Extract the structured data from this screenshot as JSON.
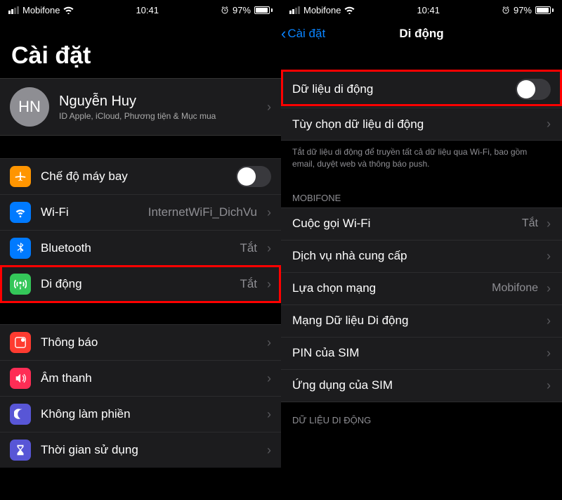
{
  "status": {
    "carrier": "Mobifone",
    "time": "10:41",
    "battery_pct": "97%"
  },
  "left": {
    "title": "Cài đặt",
    "profile": {
      "initials": "HN",
      "name": "Nguyễn Huy",
      "subtitle": "ID Apple, iCloud, Phương tiện & Mục mua"
    },
    "rows": {
      "airplane": "Chế độ máy bay",
      "wifi": "Wi-Fi",
      "wifi_value": "InternetWiFi_DichVu",
      "bluetooth": "Bluetooth",
      "bluetooth_value": "Tắt",
      "cellular": "Di động",
      "cellular_value": "Tắt",
      "notifications": "Thông báo",
      "sounds": "Âm thanh",
      "dnd": "Không làm phiền",
      "screentime": "Thời gian sử dụng"
    }
  },
  "right": {
    "back_label": "Cài đặt",
    "title": "Di động",
    "rows": {
      "cellular_data": "Dữ liệu di động",
      "data_options": "Tùy chọn dữ liệu di động"
    },
    "footer": "Tắt dữ liệu di động để truyền tất cả dữ liệu qua Wi-Fi, bao gồm email, duyệt web và thông báo push.",
    "section_carrier": "MOBIFONE",
    "carrier_rows": {
      "wifi_calling": "Cuộc gọi Wi-Fi",
      "wifi_calling_value": "Tắt",
      "carrier_services": "Dịch vụ nhà cung cấp",
      "network": "Lựa chọn mạng",
      "network_value": "Mobifone",
      "cellular_network": "Mạng Dữ liệu Di động",
      "sim_pin": "PIN của SIM",
      "sim_apps": "Ứng dụng của SIM"
    },
    "section_data": "DỮ LIỆU DI ĐỘNG"
  }
}
